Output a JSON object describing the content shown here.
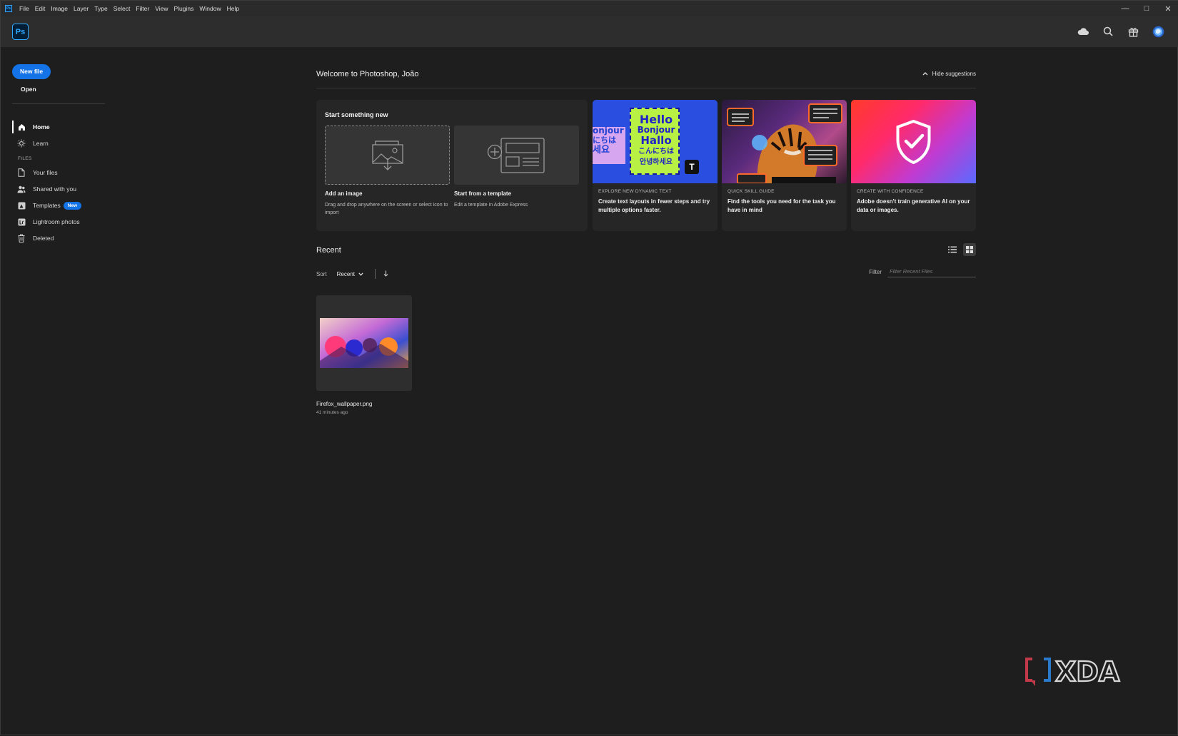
{
  "menubar": {
    "items": [
      "File",
      "Edit",
      "Image",
      "Layer",
      "Type",
      "Select",
      "Filter",
      "View",
      "Plugins",
      "Window",
      "Help"
    ],
    "window_controls": [
      "minimize-icon",
      "maximize-icon",
      "close-icon"
    ]
  },
  "header": {
    "app_logo": "Ps",
    "icons": [
      "cloud-icon",
      "search-icon",
      "gift-icon",
      "avatar"
    ]
  },
  "sidebar": {
    "new_file": "New file",
    "open": "Open",
    "nav": [
      {
        "label": "Home",
        "icon": "home-icon",
        "active": true
      },
      {
        "label": "Learn",
        "icon": "lightbulb-icon",
        "active": false
      }
    ],
    "files_header": "FILES",
    "files": [
      {
        "label": "Your files",
        "icon": "file-icon"
      },
      {
        "label": "Shared with you",
        "icon": "people-icon"
      },
      {
        "label": "Templates",
        "icon": "templates-icon",
        "badge": "New"
      },
      {
        "label": "Lightroom photos",
        "icon": "lightroom-icon"
      },
      {
        "label": "Deleted",
        "icon": "trash-icon"
      }
    ]
  },
  "main": {
    "welcome": "Welcome to Photoshop, João",
    "hide_suggestions": "Hide suggestions",
    "start": {
      "title": "Start something new",
      "add_image_label": "Add an image",
      "add_image_desc": "Drag and drop anywhere on the screen or select icon to import",
      "template_label": "Start from a template",
      "template_desc": "Edit a template in Adobe Express"
    },
    "promos": [
      {
        "eyebrow": "EXPLORE NEW DYNAMIC TEXT",
        "title": "Create text layouts in fewer steps and try multiple options faster."
      },
      {
        "eyebrow": "QUICK SKILL GUIDE",
        "title": "Find the tools you need for the task you have in mind"
      },
      {
        "eyebrow": "CREATE WITH CONFIDENCE",
        "title": "Adobe doesn't train generative AI on your data or images."
      }
    ],
    "promo_art_text": {
      "words": [
        "Hello",
        "Bonjour",
        "Hallo",
        "こんにちは",
        "안녕하세요"
      ],
      "side": [
        "onjour",
        "にちは",
        "세요"
      ]
    },
    "recent": {
      "title": "Recent",
      "sort_label": "Sort",
      "sort_value": "Recent",
      "filter_label": "Filter",
      "filter_placeholder": "Filter Recent Files",
      "files": [
        {
          "name": "Firefox_wallpaper.png",
          "time": "41 minutes ago"
        }
      ]
    }
  },
  "watermark": "XDA",
  "colors": {
    "accent": "#1473e6",
    "bg": "#1e1e1e",
    "panel": "#262626",
    "ps_blue": "#31a8ff"
  }
}
